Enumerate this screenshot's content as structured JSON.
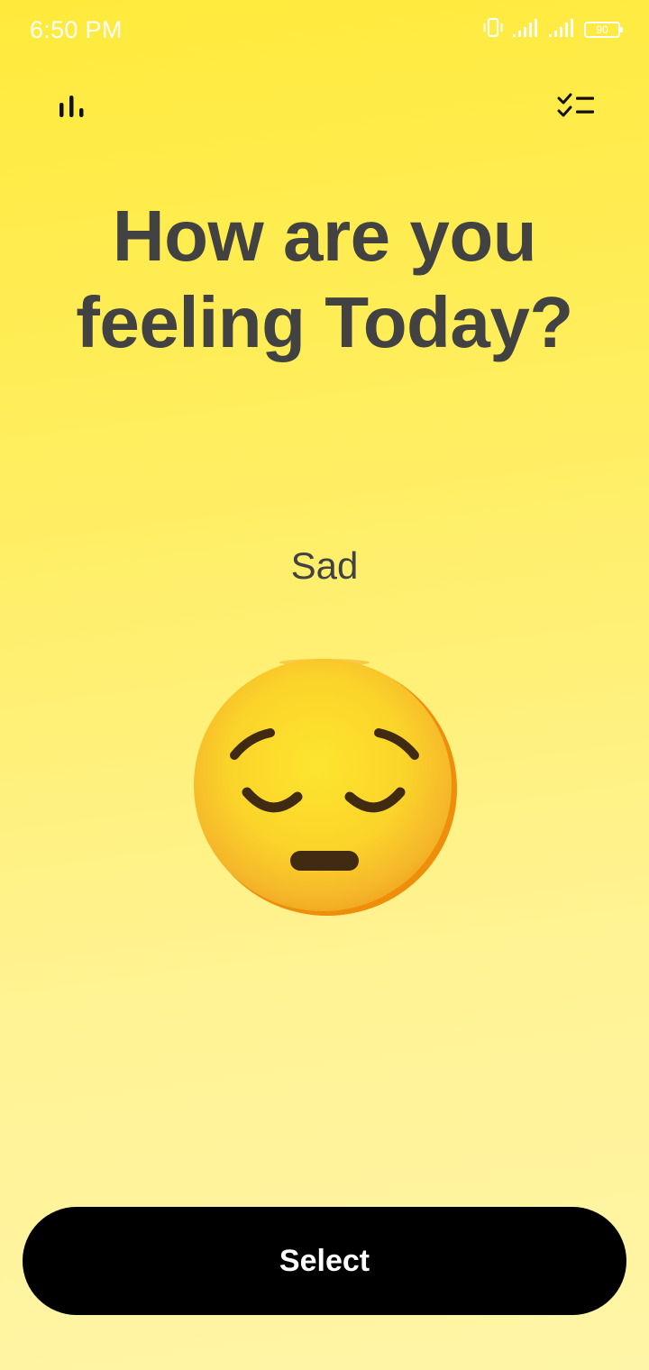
{
  "status_bar": {
    "time": "6:50 PM",
    "battery_percent": "90",
    "icons": [
      "vibrate-icon",
      "signal-icon",
      "signal-icon",
      "battery-icon"
    ]
  },
  "toolbar": {
    "left_icon": "bar-chart-icon",
    "right_icon": "checklist-icon"
  },
  "main": {
    "title": "How are you feeling Today?",
    "mood_label": "Sad",
    "mood_emoji": "pensive-face-icon"
  },
  "actions": {
    "select_label": "Select"
  },
  "colors": {
    "background_top": "#FFEA3B",
    "background_bottom": "#FFF5A6",
    "text_dark": "#424242",
    "button_bg": "#000000",
    "button_text": "#FFFFFF"
  }
}
